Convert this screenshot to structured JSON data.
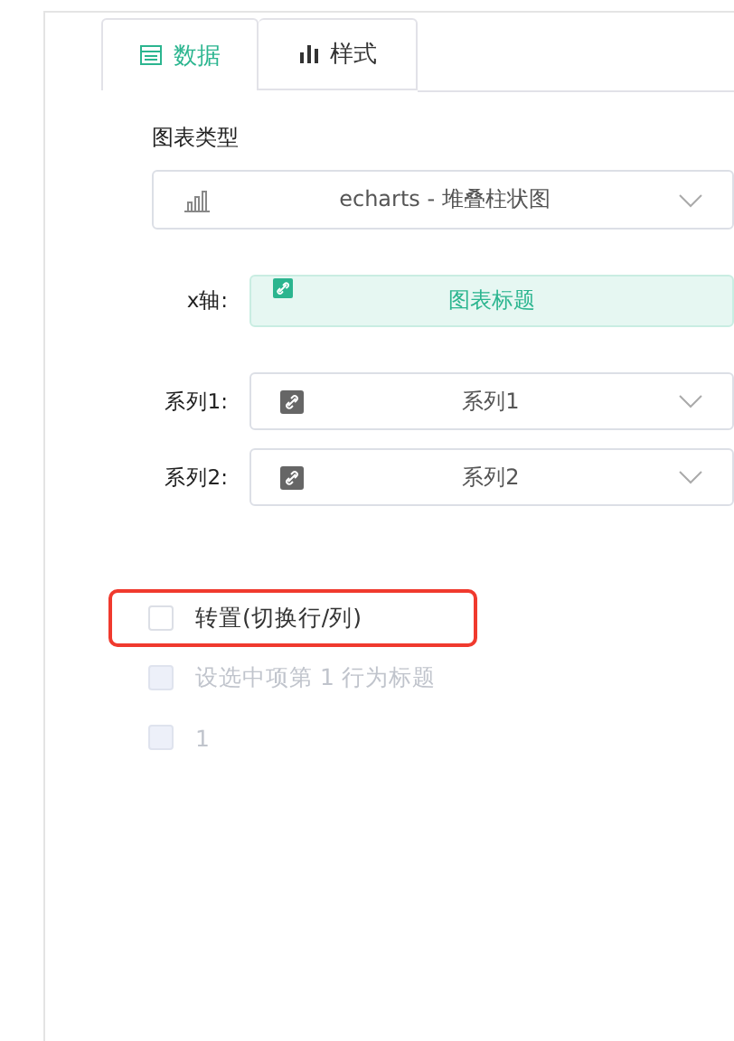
{
  "tabs": [
    {
      "label": "数据",
      "selected": true
    },
    {
      "label": "样式",
      "selected": false
    }
  ],
  "chart_type": {
    "label": "图表类型",
    "value": "echarts - 堆叠柱状图"
  },
  "x_axis": {
    "label": "x轴:",
    "value": "图表标题"
  },
  "series": [
    {
      "label": "系列1:",
      "value": "系列1"
    },
    {
      "label": "系列2:",
      "value": "系列2"
    }
  ],
  "options": [
    {
      "label": "转置(切换行/列)",
      "checked": false,
      "disabled": false,
      "highlighted": true
    },
    {
      "label": "设选中项第 1 行为标题",
      "checked": false,
      "disabled": true,
      "highlighted": false
    },
    {
      "label": "1",
      "checked": false,
      "disabled": true,
      "highlighted": false
    }
  ]
}
